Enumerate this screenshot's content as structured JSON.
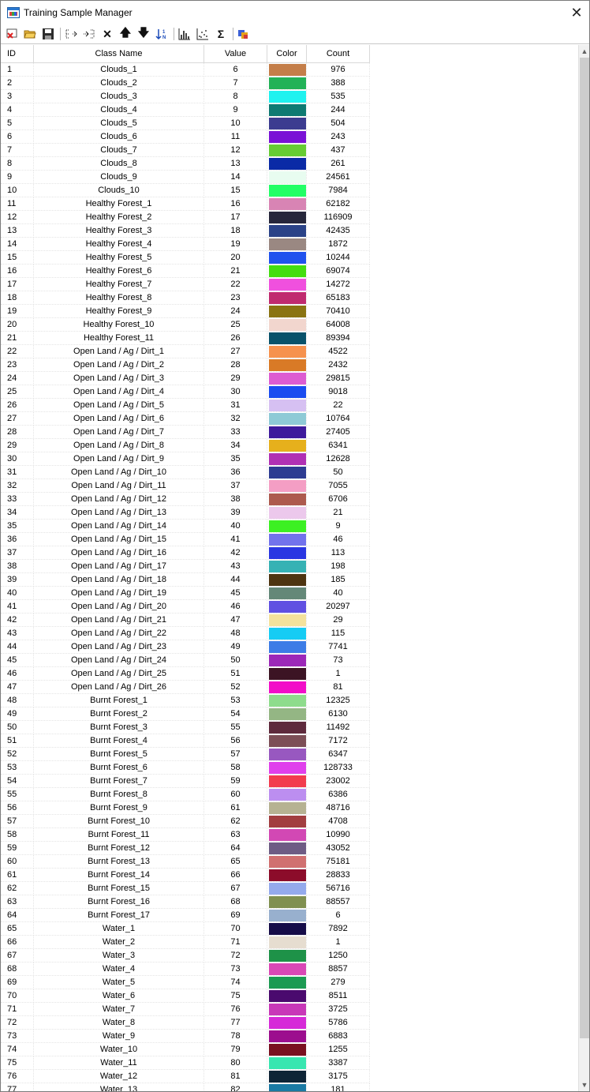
{
  "window": {
    "title": "Training Sample Manager",
    "close_label": "✕"
  },
  "toolbar": [
    {
      "name": "new-class-icon",
      "glyph": ""
    },
    {
      "name": "open-folder-icon",
      "glyph": ""
    },
    {
      "name": "save-icon",
      "glyph": ""
    },
    {
      "name": "sep"
    },
    {
      "name": "merge-classes-icon",
      "glyph": ""
    },
    {
      "name": "split-classes-icon",
      "glyph": ""
    },
    {
      "name": "delete-icon",
      "glyph": "✕"
    },
    {
      "name": "move-up-icon",
      "glyph": "🡅"
    },
    {
      "name": "move-down-icon",
      "glyph": "🡇"
    },
    {
      "name": "sort-icon",
      "glyph": ""
    },
    {
      "name": "sep"
    },
    {
      "name": "histogram-icon",
      "glyph": ""
    },
    {
      "name": "scatterplot-icon",
      "glyph": ""
    },
    {
      "name": "statistics-sigma-icon",
      "glyph": "Σ"
    },
    {
      "name": "sep"
    },
    {
      "name": "palette-icon",
      "glyph": ""
    }
  ],
  "columns": {
    "id": "ID",
    "name": "Class Name",
    "value": "Value",
    "color": "Color",
    "count": "Count"
  },
  "rows": [
    {
      "id": "1",
      "name": "Clouds_1",
      "value": "6",
      "color": "#c47e49",
      "count": "976"
    },
    {
      "id": "2",
      "name": "Clouds_2",
      "value": "7",
      "color": "#22b257",
      "count": "388"
    },
    {
      "id": "3",
      "name": "Clouds_3",
      "value": "8",
      "color": "#1ff2ef",
      "count": "535"
    },
    {
      "id": "4",
      "name": "Clouds_4",
      "value": "9",
      "color": "#0f7a72",
      "count": "244"
    },
    {
      "id": "5",
      "name": "Clouds_5",
      "value": "10",
      "color": "#3c3c90",
      "count": "504"
    },
    {
      "id": "6",
      "name": "Clouds_6",
      "value": "11",
      "color": "#7a12d6",
      "count": "243"
    },
    {
      "id": "7",
      "name": "Clouds_7",
      "value": "12",
      "color": "#66cc33",
      "count": "437"
    },
    {
      "id": "8",
      "name": "Clouds_8",
      "value": "13",
      "color": "#0a2aa6",
      "count": "261"
    },
    {
      "id": "9",
      "name": "Clouds_9",
      "value": "14",
      "color": "#e8fcf0",
      "count": "24561"
    },
    {
      "id": "10",
      "name": "Clouds_10",
      "value": "15",
      "color": "#22ff66",
      "count": "7984"
    },
    {
      "id": "11",
      "name": "Healthy Forest_1",
      "value": "16",
      "color": "#d884b4",
      "count": "62182"
    },
    {
      "id": "12",
      "name": "Healthy Forest_2",
      "value": "17",
      "color": "#26263a",
      "count": "116909"
    },
    {
      "id": "13",
      "name": "Healthy Forest_3",
      "value": "18",
      "color": "#2a4287",
      "count": "42435"
    },
    {
      "id": "14",
      "name": "Healthy Forest_4",
      "value": "19",
      "color": "#9a8882",
      "count": "1872"
    },
    {
      "id": "15",
      "name": "Healthy Forest_5",
      "value": "20",
      "color": "#2052ee",
      "count": "10244"
    },
    {
      "id": "16",
      "name": "Healthy Forest_6",
      "value": "21",
      "color": "#44dd11",
      "count": "69074"
    },
    {
      "id": "17",
      "name": "Healthy Forest_7",
      "value": "22",
      "color": "#f050de",
      "count": "14272"
    },
    {
      "id": "18",
      "name": "Healthy Forest_8",
      "value": "23",
      "color": "#c02b6f",
      "count": "65183"
    },
    {
      "id": "19",
      "name": "Healthy Forest_9",
      "value": "24",
      "color": "#8a7412",
      "count": "70410"
    },
    {
      "id": "20",
      "name": "Healthy Forest_10",
      "value": "25",
      "color": "#f2d6ce",
      "count": "64008"
    },
    {
      "id": "21",
      "name": "Healthy Forest_11",
      "value": "26",
      "color": "#08526a",
      "count": "89394"
    },
    {
      "id": "22",
      "name": "Open Land / Ag / Dirt_1",
      "value": "27",
      "color": "#f6924e",
      "count": "4522"
    },
    {
      "id": "23",
      "name": "Open Land / Ag / Dirt_2",
      "value": "28",
      "color": "#d97a26",
      "count": "2432"
    },
    {
      "id": "24",
      "name": "Open Land / Ag / Dirt_3",
      "value": "29",
      "color": "#dd5cd2",
      "count": "29815"
    },
    {
      "id": "25",
      "name": "Open Land / Ag / Dirt_4",
      "value": "30",
      "color": "#1a4cf0",
      "count": "9018"
    },
    {
      "id": "26",
      "name": "Open Land / Ag / Dirt_5",
      "value": "31",
      "color": "#d6c0f2",
      "count": "22"
    },
    {
      "id": "27",
      "name": "Open Land / Ag / Dirt_6",
      "value": "32",
      "color": "#8ecad6",
      "count": "10764"
    },
    {
      "id": "28",
      "name": "Open Land / Ag / Dirt_7",
      "value": "33",
      "color": "#3e1a9c",
      "count": "27405"
    },
    {
      "id": "29",
      "name": "Open Land / Ag / Dirt_8",
      "value": "34",
      "color": "#e6b01c",
      "count": "6341"
    },
    {
      "id": "30",
      "name": "Open Land / Ag / Dirt_9",
      "value": "35",
      "color": "#b030b4",
      "count": "12628"
    },
    {
      "id": "31",
      "name": "Open Land / Ag / Dirt_10",
      "value": "36",
      "color": "#2d3c92",
      "count": "50"
    },
    {
      "id": "32",
      "name": "Open Land / Ag / Dirt_11",
      "value": "37",
      "color": "#f49ec4",
      "count": "7055"
    },
    {
      "id": "33",
      "name": "Open Land / Ag / Dirt_12",
      "value": "38",
      "color": "#ad5a4e",
      "count": "6706"
    },
    {
      "id": "34",
      "name": "Open Land / Ag / Dirt_13",
      "value": "39",
      "color": "#ecc8ec",
      "count": "21"
    },
    {
      "id": "35",
      "name": "Open Land / Ag / Dirt_14",
      "value": "40",
      "color": "#3cf023",
      "count": "9"
    },
    {
      "id": "36",
      "name": "Open Land / Ag / Dirt_15",
      "value": "41",
      "color": "#7272ec",
      "count": "46"
    },
    {
      "id": "37",
      "name": "Open Land / Ag / Dirt_16",
      "value": "42",
      "color": "#2a36e2",
      "count": "113"
    },
    {
      "id": "38",
      "name": "Open Land / Ag / Dirt_17",
      "value": "43",
      "color": "#36b2b4",
      "count": "198"
    },
    {
      "id": "39",
      "name": "Open Land / Ag / Dirt_18",
      "value": "44",
      "color": "#4e3410",
      "count": "185"
    },
    {
      "id": "40",
      "name": "Open Land / Ag / Dirt_19",
      "value": "45",
      "color": "#648878",
      "count": "40"
    },
    {
      "id": "41",
      "name": "Open Land / Ag / Dirt_20",
      "value": "46",
      "color": "#6050e2",
      "count": "20297"
    },
    {
      "id": "42",
      "name": "Open Land / Ag / Dirt_21",
      "value": "47",
      "color": "#f4e29c",
      "count": "29"
    },
    {
      "id": "43",
      "name": "Open Land / Ag / Dirt_22",
      "value": "48",
      "color": "#16ccf4",
      "count": "115"
    },
    {
      "id": "44",
      "name": "Open Land / Ag / Dirt_23",
      "value": "49",
      "color": "#3c7ce6",
      "count": "7741"
    },
    {
      "id": "45",
      "name": "Open Land / Ag / Dirt_24",
      "value": "50",
      "color": "#9c28b8",
      "count": "73"
    },
    {
      "id": "46",
      "name": "Open Land / Ag / Dirt_25",
      "value": "51",
      "color": "#3c1424",
      "count": "1"
    },
    {
      "id": "47",
      "name": "Open Land / Ag / Dirt_26",
      "value": "52",
      "color": "#f20ec8",
      "count": "81"
    },
    {
      "id": "48",
      "name": "Burnt Forest_1",
      "value": "53",
      "color": "#8edc8c",
      "count": "12325"
    },
    {
      "id": "49",
      "name": "Burnt Forest_2",
      "value": "54",
      "color": "#94b684",
      "count": "6130"
    },
    {
      "id": "50",
      "name": "Burnt Forest_3",
      "value": "55",
      "color": "#5e2a3c",
      "count": "11492"
    },
    {
      "id": "51",
      "name": "Burnt Forest_4",
      "value": "56",
      "color": "#7c4e56",
      "count": "7172"
    },
    {
      "id": "52",
      "name": "Burnt Forest_5",
      "value": "57",
      "color": "#9858c0",
      "count": "6347"
    },
    {
      "id": "53",
      "name": "Burnt Forest_6",
      "value": "58",
      "color": "#e040ec",
      "count": "128733"
    },
    {
      "id": "54",
      "name": "Burnt Forest_7",
      "value": "59",
      "color": "#f23c4e",
      "count": "23002"
    },
    {
      "id": "55",
      "name": "Burnt Forest_8",
      "value": "60",
      "color": "#bc8ef0",
      "count": "6386"
    },
    {
      "id": "56",
      "name": "Burnt Forest_9",
      "value": "61",
      "color": "#b6b292",
      "count": "48716"
    },
    {
      "id": "57",
      "name": "Burnt Forest_10",
      "value": "62",
      "color": "#a23e40",
      "count": "4708"
    },
    {
      "id": "58",
      "name": "Burnt Forest_11",
      "value": "63",
      "color": "#d248b4",
      "count": "10990"
    },
    {
      "id": "59",
      "name": "Burnt Forest_12",
      "value": "64",
      "color": "#6e5c84",
      "count": "43052"
    },
    {
      "id": "60",
      "name": "Burnt Forest_13",
      "value": "65",
      "color": "#d07070",
      "count": "75181"
    },
    {
      "id": "61",
      "name": "Burnt Forest_14",
      "value": "66",
      "color": "#8c0c2a",
      "count": "28833"
    },
    {
      "id": "62",
      "name": "Burnt Forest_15",
      "value": "67",
      "color": "#94aaec",
      "count": "56716"
    },
    {
      "id": "63",
      "name": "Burnt Forest_16",
      "value": "68",
      "color": "#809050",
      "count": "88557"
    },
    {
      "id": "64",
      "name": "Burnt Forest_17",
      "value": "69",
      "color": "#98b0ce",
      "count": "6"
    },
    {
      "id": "65",
      "name": "Water_1",
      "value": "70",
      "color": "#160c48",
      "count": "7892"
    },
    {
      "id": "66",
      "name": "Water_2",
      "value": "71",
      "color": "#e6ddd0",
      "count": "1"
    },
    {
      "id": "67",
      "name": "Water_3",
      "value": "72",
      "color": "#1e9248",
      "count": "1250"
    },
    {
      "id": "68",
      "name": "Water_4",
      "value": "73",
      "color": "#da48b6",
      "count": "8857"
    },
    {
      "id": "69",
      "name": "Water_5",
      "value": "74",
      "color": "#1c9a52",
      "count": "279"
    },
    {
      "id": "70",
      "name": "Water_6",
      "value": "75",
      "color": "#4a0a6e",
      "count": "8511"
    },
    {
      "id": "71",
      "name": "Water_7",
      "value": "76",
      "color": "#c838b8",
      "count": "3725"
    },
    {
      "id": "72",
      "name": "Water_8",
      "value": "77",
      "color": "#d62ad8",
      "count": "5786"
    },
    {
      "id": "73",
      "name": "Water_9",
      "value": "78",
      "color": "#9c0e8e",
      "count": "6883"
    },
    {
      "id": "74",
      "name": "Water_10",
      "value": "79",
      "color": "#7a1020",
      "count": "1255"
    },
    {
      "id": "75",
      "name": "Water_11",
      "value": "80",
      "color": "#38e6b0",
      "count": "3387"
    },
    {
      "id": "76",
      "name": "Water_12",
      "value": "81",
      "color": "#0e2436",
      "count": "3175"
    },
    {
      "id": "77",
      "name": "Water_13",
      "value": "82",
      "color": "#1a7aa4",
      "count": "181"
    }
  ],
  "scrollbar": {
    "up_glyph": "▲",
    "down_glyph": "▼"
  }
}
